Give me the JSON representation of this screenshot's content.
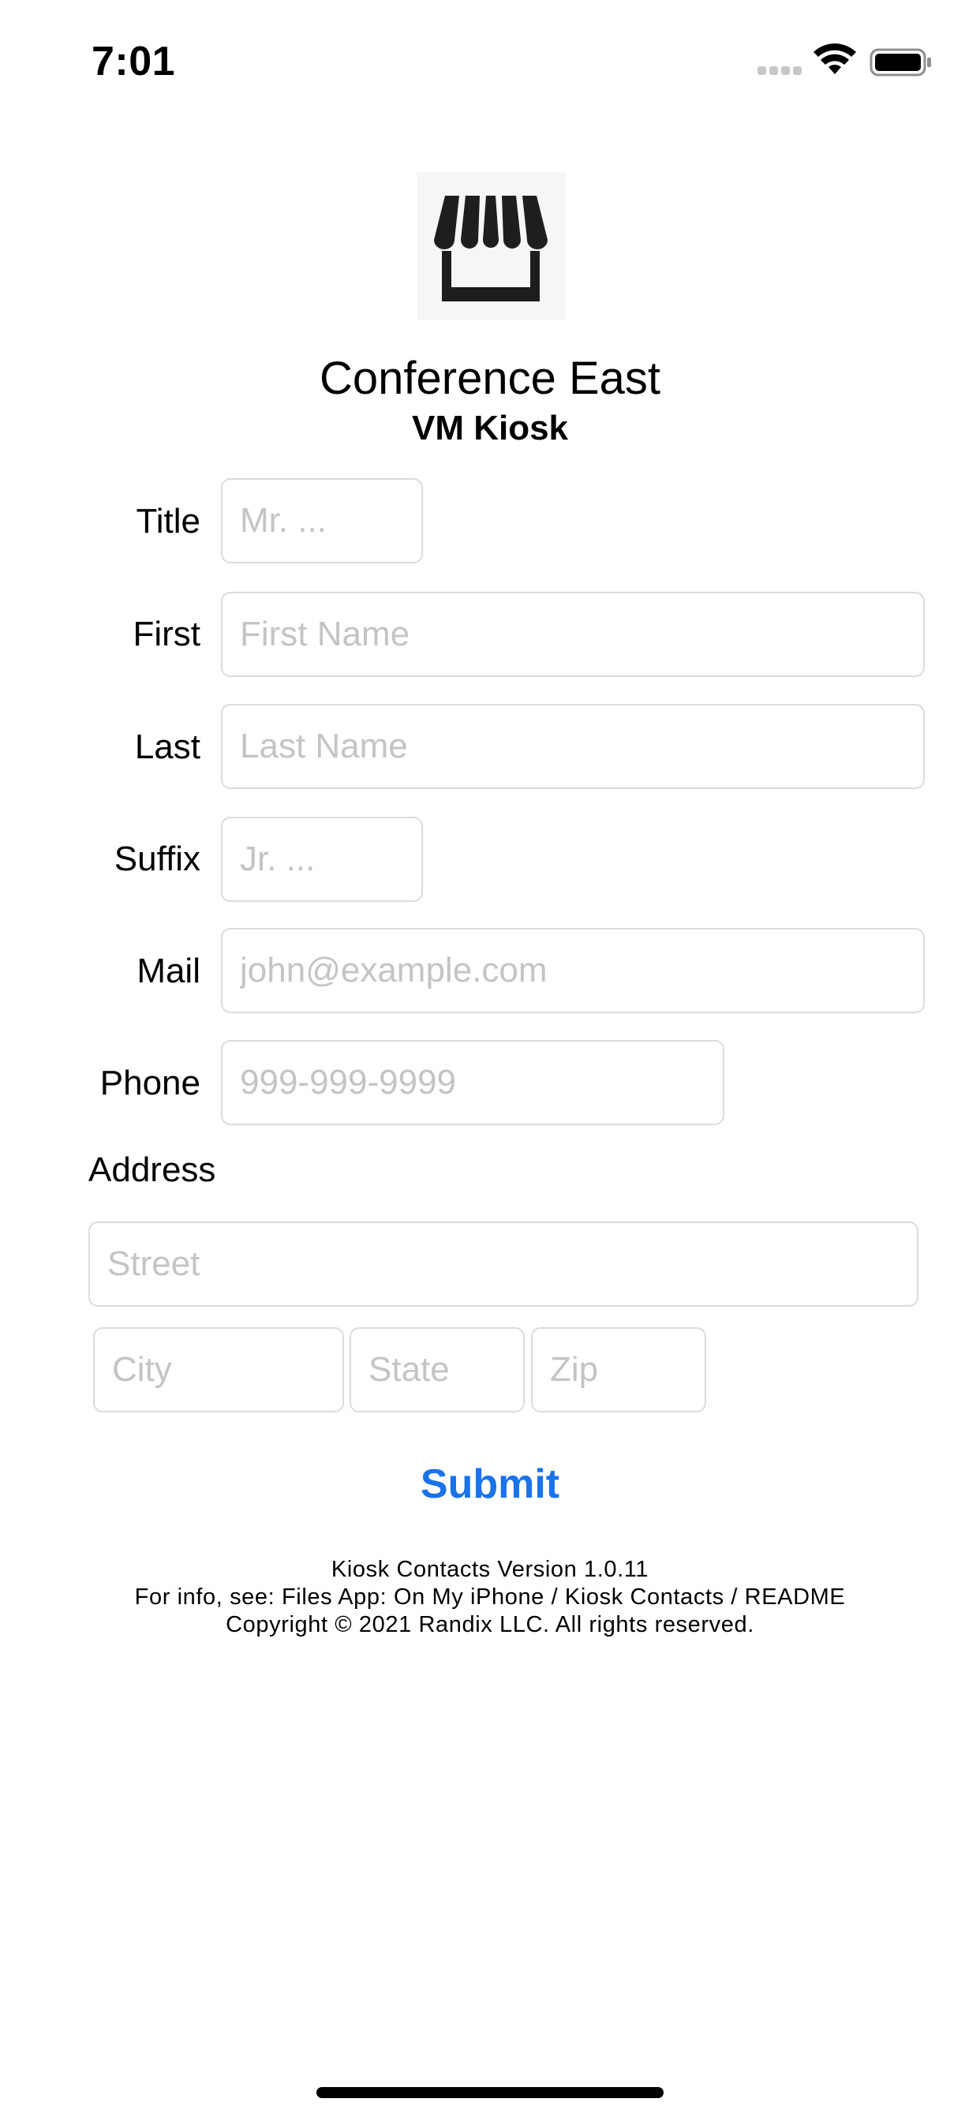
{
  "status_bar": {
    "time": "7:01"
  },
  "app": {
    "logo_icon": "storefront-awning-icon",
    "title": "Conference East",
    "subtitle": "VM Kiosk"
  },
  "form": {
    "fields": [
      {
        "label": "Title",
        "placeholder": "Mr. ...",
        "value": ""
      },
      {
        "label": "First",
        "placeholder": "First Name",
        "value": ""
      },
      {
        "label": "Last",
        "placeholder": "Last Name",
        "value": ""
      },
      {
        "label": "Suffix",
        "placeholder": "Jr. ...",
        "value": ""
      },
      {
        "label": "Mail",
        "placeholder": "john@example.com",
        "value": ""
      },
      {
        "label": "Phone",
        "placeholder": "999-999-9999",
        "value": ""
      }
    ],
    "address": {
      "label": "Address",
      "street_placeholder": "Street",
      "city_placeholder": "City",
      "state_placeholder": "State",
      "zip_placeholder": "Zip"
    },
    "submit_label": "Submit"
  },
  "footer": {
    "version": "Kiosk Contacts Version 1.0.11",
    "info": "For info, see: Files App: On My iPhone / Kiosk Contacts / README",
    "copyright": "Copyright © 2021 Randix LLC. All rights reserved."
  },
  "colors": {
    "accent": "#1a73e8",
    "placeholder": "#c4c4c6",
    "field_border": "#dcdcdc"
  }
}
